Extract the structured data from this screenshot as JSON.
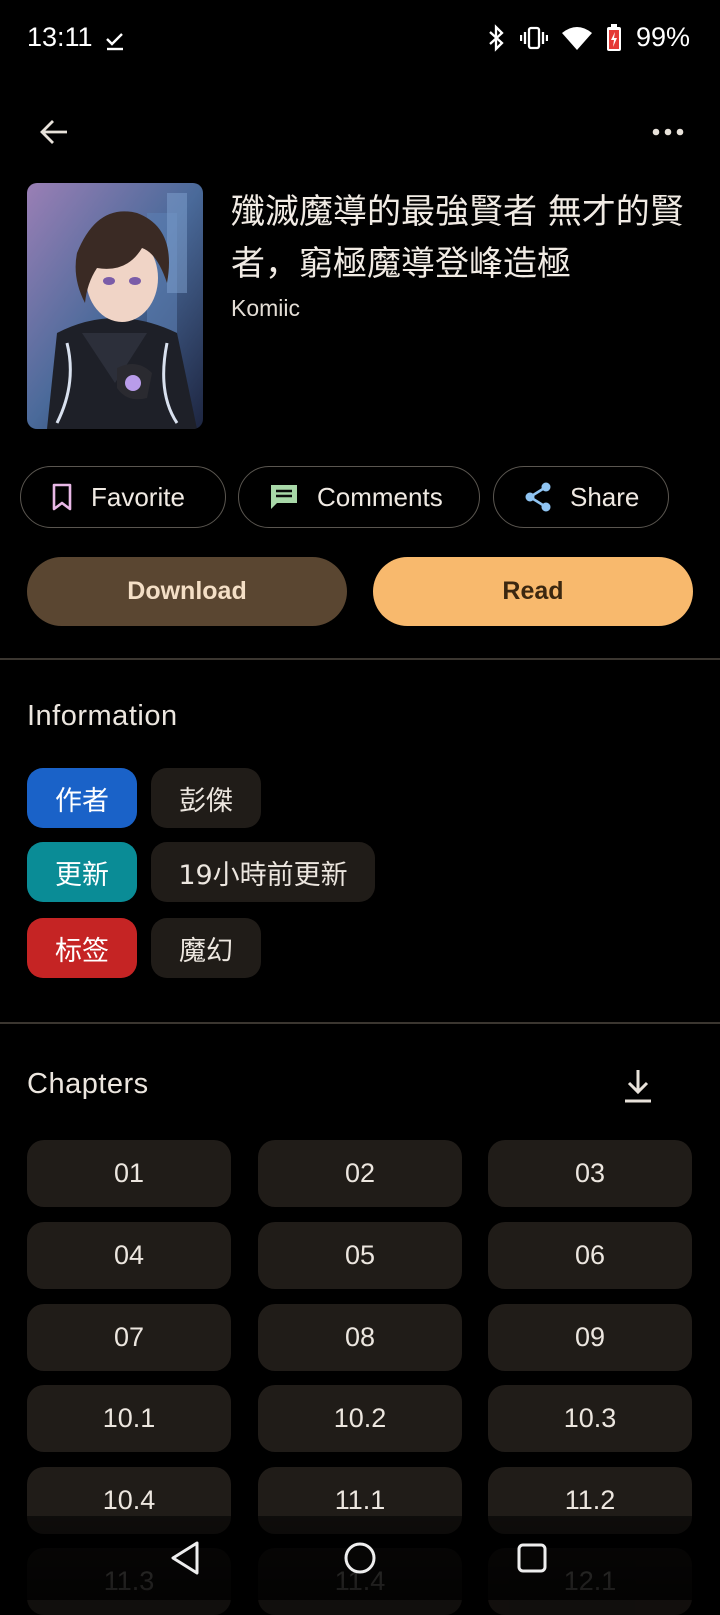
{
  "status": {
    "time": "13:11",
    "battery": "99%"
  },
  "manga": {
    "title": "殲滅魔導的最強賢者 無才的賢者，窮極魔導登峰造極",
    "source": "Komiic"
  },
  "actions": {
    "favorite": "Favorite",
    "comments": "Comments",
    "share": "Share"
  },
  "buttons": {
    "download": "Download",
    "read": "Read"
  },
  "information": {
    "heading": "Information",
    "rows": [
      {
        "key": "作者",
        "value": "彭傑",
        "color": "#1a62c8"
      },
      {
        "key": "更新",
        "value": "19小時前更新",
        "color": "#0a8c96"
      },
      {
        "key": "标签",
        "value": "魔幻",
        "color": "#c52424"
      }
    ]
  },
  "chapters": {
    "heading": "Chapters",
    "items": [
      "01",
      "02",
      "03",
      "04",
      "05",
      "06",
      "07",
      "08",
      "09",
      "10.1",
      "10.2",
      "10.3",
      "10.4",
      "11.1",
      "11.2",
      "11.3",
      "11.4",
      "12.1"
    ]
  },
  "colors": {
    "accent": "#f8b96d",
    "download_bg": "#5a4631",
    "chip_bg": "#201c18"
  },
  "icons": [
    "back-arrow-icon",
    "more-icon",
    "bookmark-icon",
    "comment-icon",
    "share-icon",
    "download-icon",
    "nav-back-icon",
    "nav-home-icon",
    "nav-recents-icon"
  ]
}
